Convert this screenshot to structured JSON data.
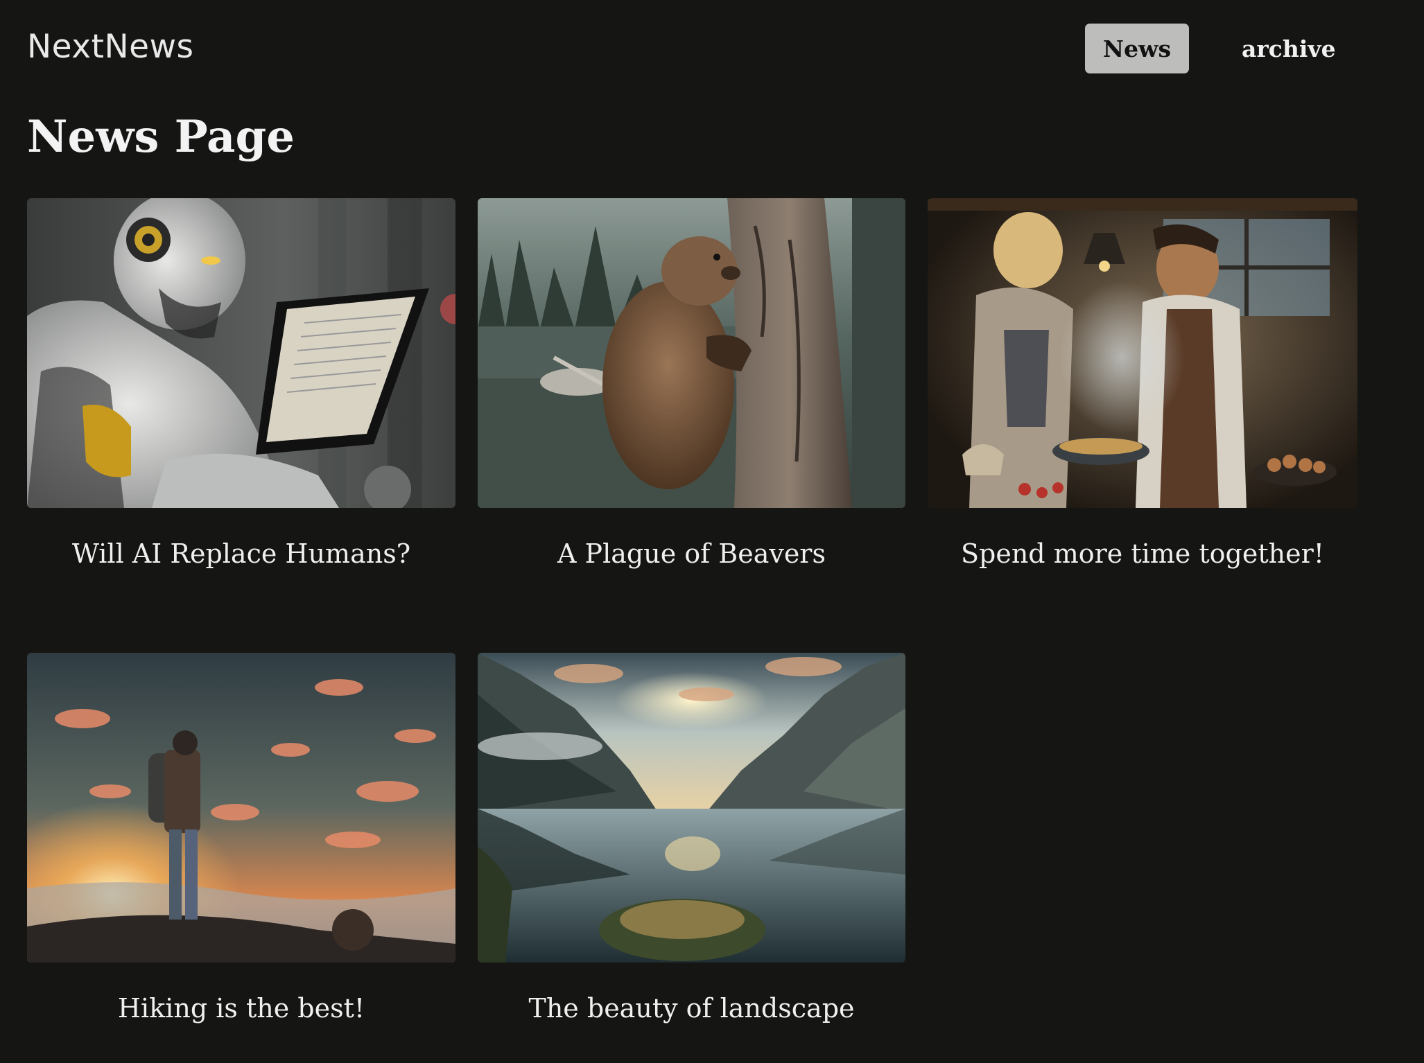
{
  "header": {
    "logo": "NextNews",
    "nav": [
      {
        "label": "News",
        "active": true
      },
      {
        "label": "archive",
        "active": false
      }
    ]
  },
  "main": {
    "title": "News Page",
    "articles": [
      {
        "title": "Will AI Replace Humans?",
        "image": "robot-with-tablet"
      },
      {
        "title": "A Plague of Beavers",
        "image": "beaver-on-tree"
      },
      {
        "title": "Spend more time together!",
        "image": "couple-cooking"
      },
      {
        "title": "Hiking is the best!",
        "image": "hiker-at-sunset"
      },
      {
        "title": "The beauty of landscape",
        "image": "mountain-lake"
      }
    ]
  },
  "colors": {
    "background": "#151513",
    "active_nav_bg": "#bdbdbb",
    "text": "#f0f0f0"
  }
}
